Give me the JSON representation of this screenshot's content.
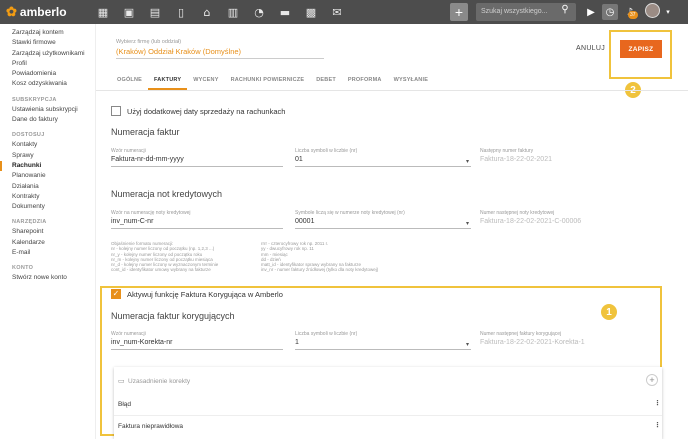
{
  "app": {
    "name": "amberlo"
  },
  "topbar": {
    "search_placeholder": "Szukaj wszystkiego...",
    "notif_count": "37"
  },
  "sidebar": {
    "group1": [
      "Zarządzaj kontem",
      "Stawki firmowe",
      "Zarządzaj użytkownikami",
      "Profil",
      "Powiadomienia",
      "Kosz odzyskiwania"
    ],
    "sec_sub": "SUBSKRYPCJA",
    "group2": [
      "Ustawienia subskrypcji",
      "Dane do faktury"
    ],
    "sec_dost": "DOSTOSUJ",
    "group3": [
      "Kontakty",
      "Sprawy",
      "Rachunki",
      "Planowanie",
      "Działania",
      "Kontrakty",
      "Dokumenty"
    ],
    "sec_narz": "NARZĘDZIA",
    "group4": [
      "Sharepoint",
      "Kalendarze",
      "E-mail"
    ],
    "sec_konto": "KONTO",
    "group5": [
      "Stwórz nowe konto"
    ]
  },
  "header": {
    "company_label": "Wybierz firmę (lub oddział)",
    "company": "(Kraków) Oddział Kraków (Domyślne)",
    "cancel": "ANULUJ",
    "save": "ZAPISZ"
  },
  "tabs": [
    "OGÓLNE",
    "FAKTURY",
    "WYCENY",
    "RACHUNKI POWIERNICZE",
    "DEBET",
    "PROFORMA",
    "WYSYŁANIE"
  ],
  "sale_date_check": "Użyj dodatkowej daty sprzedaży na rachunkach",
  "invoice": {
    "title": "Numeracja faktur",
    "pattern_label": "Wzór numeracji",
    "pattern": "Faktura-nr-dd-mm-yyyy",
    "digits_label": "Liczba symboli w liczbie (nr)",
    "digits": "01",
    "next_label": "Następny numer faktury",
    "next": "Faktura-18-22-02-2021"
  },
  "credit": {
    "title": "Numeracja not kredytowych",
    "pattern_label": "Wzór na numerację noty kredytowej",
    "pattern": "inv_num-C-nr",
    "digits_label": "Symbole liczą się w numerze noty kredytowej (nr)",
    "digits": "00001",
    "next_label": "Numer następnej noty kredytowej",
    "next": "Faktura-18-22-02-2021-C-00006"
  },
  "format_help": {
    "left": [
      "Objaśnienie formatu numeracji:",
      "nr - kolejny numer liczony od początku (np. 1,2,3 ...)",
      "nr_y - kolejny numer liczony od początku roku",
      "nr_m - kolejny numer liczony od początku miesiąca",
      "nr_d - kolejny numer liczony w wyznaczonym terminie",
      "cont_id - identyfikator umowy wybrany na fakturze"
    ],
    "right": [
      "rrrr - czterocyfrowy rok np. 2011 r.",
      "yy - dwucyfrowy rok np. 11",
      "mm - miesiąc",
      "dd - dzień",
      "matt_id - identyfikator sprawy wybrany na fakturze",
      "inv_nr - numer faktury źródłowej (tylko dla noty kredytowej)"
    ]
  },
  "correction_check": "Aktywuj funkcję Faktura Korygująca w Amberlo",
  "correction": {
    "title": "Numeracja faktur korygujących",
    "pattern_label": "Wzór numeracji",
    "pattern": "inv_num-Korekta-nr",
    "digits_label": "Liczba symboli w liczbie (nr)",
    "digits": "1",
    "next_label": "Numer następnej faktury korygującej",
    "next": "Faktura-18-22-02-2021-Korekta-1"
  },
  "reasons": {
    "title": "Uzasadnienie korekty",
    "items": [
      "Błąd",
      "Faktura nieprawidłowa"
    ]
  },
  "markers": {
    "one": "1",
    "two": "2"
  }
}
